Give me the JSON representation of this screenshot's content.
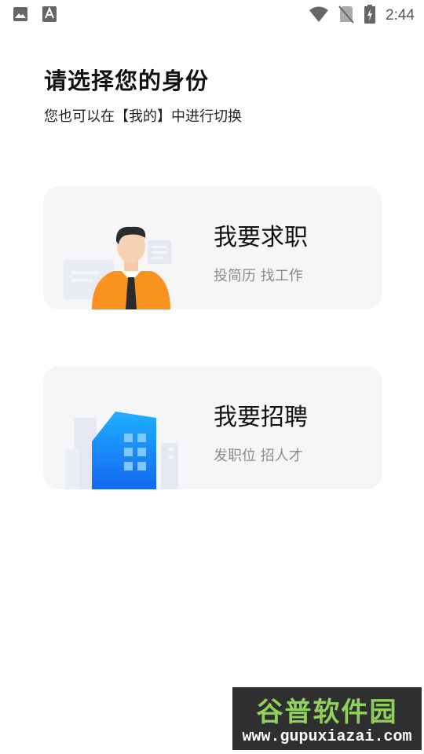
{
  "status_bar": {
    "time": "2:44",
    "left_icons": [
      "image-icon",
      "font-a-icon"
    ],
    "right_icons": [
      "wifi-icon",
      "no-sim-icon",
      "battery-charging-icon"
    ]
  },
  "header": {
    "title": "请选择您的身份",
    "subtitle": "您也可以在【我的】中进行切换"
  },
  "cards": [
    {
      "title": "我要求职",
      "description": "投简历 找工作",
      "illustration": "job-seeker-person-icon"
    },
    {
      "title": "我要招聘",
      "description": "发职位 招人才",
      "illustration": "company-building-icon"
    }
  ],
  "watermark": {
    "title": "谷普软件园",
    "url": "www.gupuxiazai.com"
  },
  "colors": {
    "card_bg": "#f6f6f8",
    "description": "#8b8b8b",
    "orange": "#f7931e",
    "blue": "#1a7bf5"
  }
}
